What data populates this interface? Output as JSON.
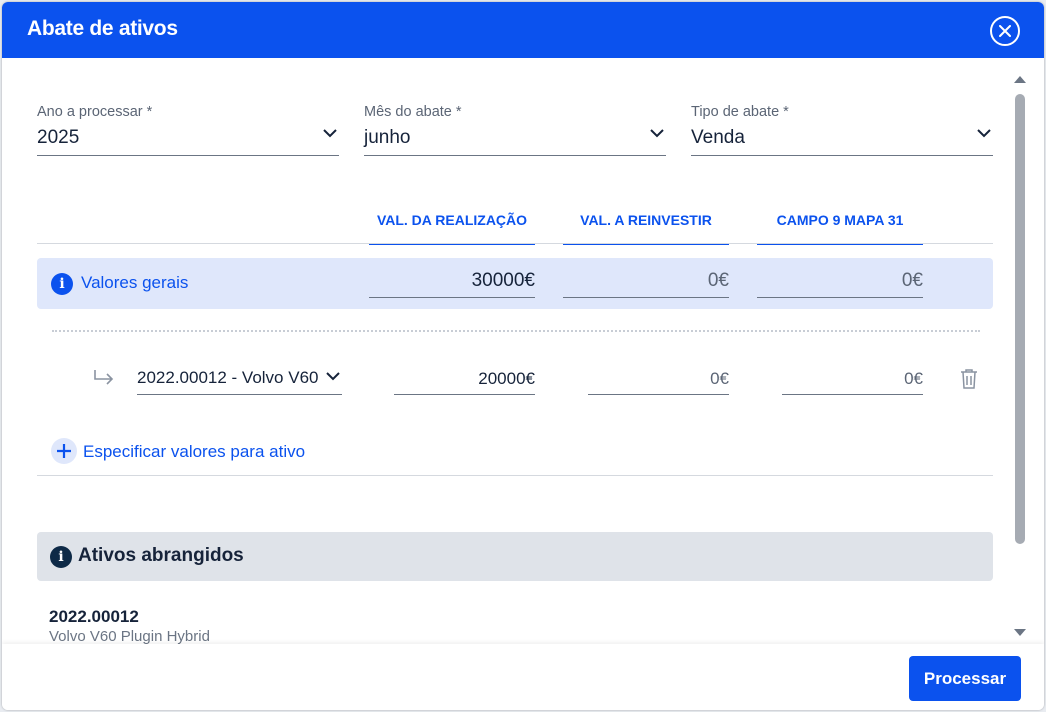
{
  "dialog": {
    "title": "Abate de ativos"
  },
  "filters": {
    "year": {
      "label": "Ano a processar *",
      "value": "2025"
    },
    "month": {
      "label": "Mês do abate *",
      "value": "junho"
    },
    "type": {
      "label": "Tipo de abate *",
      "value": "Venda"
    }
  },
  "columns": [
    "VAL. DA REALIZAÇÃO",
    "VAL. A REINVESTIR",
    "CAMPO 9 MAPA 31"
  ],
  "general": {
    "label": "Valores gerais",
    "values": [
      "30000€",
      "0€",
      "0€"
    ]
  },
  "asset_entry": {
    "asset": "2022.00012 - Volvo V60",
    "values": [
      "20000€",
      "0€",
      "0€"
    ]
  },
  "add_label": "Especificar valores para ativo",
  "covered": {
    "title": "Ativos abrangidos",
    "items": [
      {
        "code": "2022.00012",
        "name": "Volvo V60 Plugin Hybrid"
      }
    ]
  },
  "footer": {
    "process_label": "Processar"
  },
  "colors": {
    "accent": "#0b52ee",
    "highlight": "#dfe7fb",
    "dark": "#0e2a47"
  }
}
